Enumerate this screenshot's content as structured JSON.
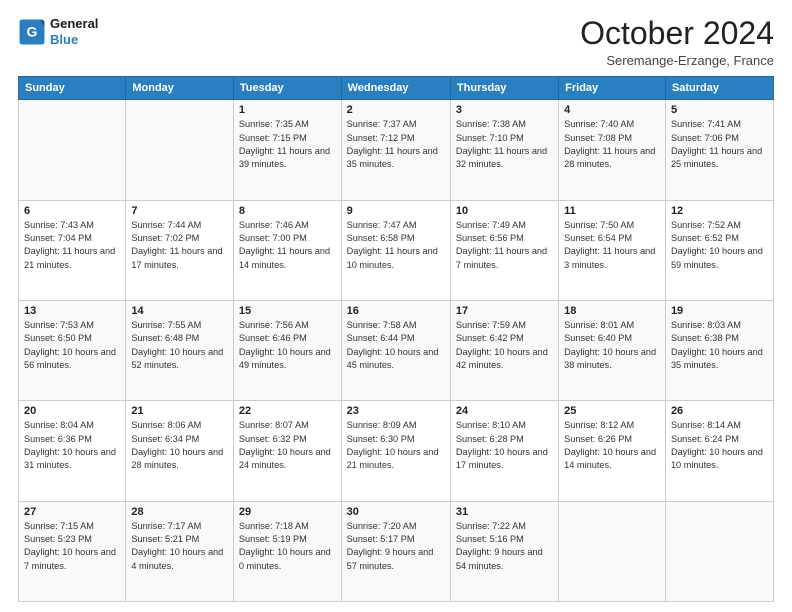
{
  "header": {
    "logo": {
      "general": "General",
      "blue": "Blue"
    },
    "title": "October 2024",
    "location": "Seremange-Erzange, France"
  },
  "days_of_week": [
    "Sunday",
    "Monday",
    "Tuesday",
    "Wednesday",
    "Thursday",
    "Friday",
    "Saturday"
  ],
  "weeks": [
    [
      {
        "day": "",
        "info": ""
      },
      {
        "day": "",
        "info": ""
      },
      {
        "day": "1",
        "info": "Sunrise: 7:35 AM\nSunset: 7:15 PM\nDaylight: 11 hours and 39 minutes."
      },
      {
        "day": "2",
        "info": "Sunrise: 7:37 AM\nSunset: 7:12 PM\nDaylight: 11 hours and 35 minutes."
      },
      {
        "day": "3",
        "info": "Sunrise: 7:38 AM\nSunset: 7:10 PM\nDaylight: 11 hours and 32 minutes."
      },
      {
        "day": "4",
        "info": "Sunrise: 7:40 AM\nSunset: 7:08 PM\nDaylight: 11 hours and 28 minutes."
      },
      {
        "day": "5",
        "info": "Sunrise: 7:41 AM\nSunset: 7:06 PM\nDaylight: 11 hours and 25 minutes."
      }
    ],
    [
      {
        "day": "6",
        "info": "Sunrise: 7:43 AM\nSunset: 7:04 PM\nDaylight: 11 hours and 21 minutes."
      },
      {
        "day": "7",
        "info": "Sunrise: 7:44 AM\nSunset: 7:02 PM\nDaylight: 11 hours and 17 minutes."
      },
      {
        "day": "8",
        "info": "Sunrise: 7:46 AM\nSunset: 7:00 PM\nDaylight: 11 hours and 14 minutes."
      },
      {
        "day": "9",
        "info": "Sunrise: 7:47 AM\nSunset: 6:58 PM\nDaylight: 11 hours and 10 minutes."
      },
      {
        "day": "10",
        "info": "Sunrise: 7:49 AM\nSunset: 6:56 PM\nDaylight: 11 hours and 7 minutes."
      },
      {
        "day": "11",
        "info": "Sunrise: 7:50 AM\nSunset: 6:54 PM\nDaylight: 11 hours and 3 minutes."
      },
      {
        "day": "12",
        "info": "Sunrise: 7:52 AM\nSunset: 6:52 PM\nDaylight: 10 hours and 59 minutes."
      }
    ],
    [
      {
        "day": "13",
        "info": "Sunrise: 7:53 AM\nSunset: 6:50 PM\nDaylight: 10 hours and 56 minutes."
      },
      {
        "day": "14",
        "info": "Sunrise: 7:55 AM\nSunset: 6:48 PM\nDaylight: 10 hours and 52 minutes."
      },
      {
        "day": "15",
        "info": "Sunrise: 7:56 AM\nSunset: 6:46 PM\nDaylight: 10 hours and 49 minutes."
      },
      {
        "day": "16",
        "info": "Sunrise: 7:58 AM\nSunset: 6:44 PM\nDaylight: 10 hours and 45 minutes."
      },
      {
        "day": "17",
        "info": "Sunrise: 7:59 AM\nSunset: 6:42 PM\nDaylight: 10 hours and 42 minutes."
      },
      {
        "day": "18",
        "info": "Sunrise: 8:01 AM\nSunset: 6:40 PM\nDaylight: 10 hours and 38 minutes."
      },
      {
        "day": "19",
        "info": "Sunrise: 8:03 AM\nSunset: 6:38 PM\nDaylight: 10 hours and 35 minutes."
      }
    ],
    [
      {
        "day": "20",
        "info": "Sunrise: 8:04 AM\nSunset: 6:36 PM\nDaylight: 10 hours and 31 minutes."
      },
      {
        "day": "21",
        "info": "Sunrise: 8:06 AM\nSunset: 6:34 PM\nDaylight: 10 hours and 28 minutes."
      },
      {
        "day": "22",
        "info": "Sunrise: 8:07 AM\nSunset: 6:32 PM\nDaylight: 10 hours and 24 minutes."
      },
      {
        "day": "23",
        "info": "Sunrise: 8:09 AM\nSunset: 6:30 PM\nDaylight: 10 hours and 21 minutes."
      },
      {
        "day": "24",
        "info": "Sunrise: 8:10 AM\nSunset: 6:28 PM\nDaylight: 10 hours and 17 minutes."
      },
      {
        "day": "25",
        "info": "Sunrise: 8:12 AM\nSunset: 6:26 PM\nDaylight: 10 hours and 14 minutes."
      },
      {
        "day": "26",
        "info": "Sunrise: 8:14 AM\nSunset: 6:24 PM\nDaylight: 10 hours and 10 minutes."
      }
    ],
    [
      {
        "day": "27",
        "info": "Sunrise: 7:15 AM\nSunset: 5:23 PM\nDaylight: 10 hours and 7 minutes."
      },
      {
        "day": "28",
        "info": "Sunrise: 7:17 AM\nSunset: 5:21 PM\nDaylight: 10 hours and 4 minutes."
      },
      {
        "day": "29",
        "info": "Sunrise: 7:18 AM\nSunset: 5:19 PM\nDaylight: 10 hours and 0 minutes."
      },
      {
        "day": "30",
        "info": "Sunrise: 7:20 AM\nSunset: 5:17 PM\nDaylight: 9 hours and 57 minutes."
      },
      {
        "day": "31",
        "info": "Sunrise: 7:22 AM\nSunset: 5:16 PM\nDaylight: 9 hours and 54 minutes."
      },
      {
        "day": "",
        "info": ""
      },
      {
        "day": "",
        "info": ""
      }
    ]
  ]
}
